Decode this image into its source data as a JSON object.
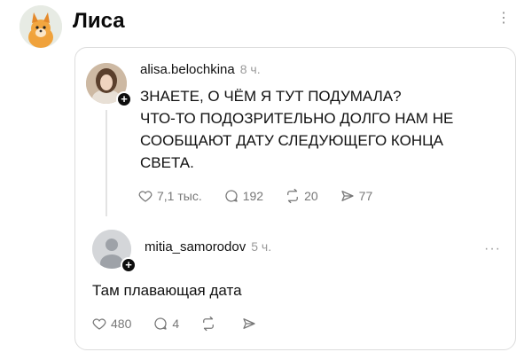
{
  "channel": {
    "name": "Лиса"
  },
  "post": {
    "username": "alisa.belochkina",
    "time": "8 ч.",
    "lines": [
      "ЗНАЕТЕ, О ЧЁМ Я ТУТ ПОДУМАЛА?",
      "ЧТО-ТО ПОДОЗРИТЕЛЬНО ДОЛГО НАМ НЕ",
      "СООБЩАЮТ ДАТУ СЛЕДУЮЩЕГО КОНЦА",
      "СВЕТА."
    ],
    "stats": {
      "likes": "7,1 тыс.",
      "comments": "192",
      "reposts": "20",
      "shares": "77"
    }
  },
  "reply": {
    "username": "mitia_samorodov",
    "time": "5 ч.",
    "text": "Там плавающая дата",
    "stats": {
      "likes": "480",
      "comments": "4"
    }
  },
  "icons": {
    "more": "vertical-ellipsis-icon",
    "reply_more": "horizontal-ellipsis-icon",
    "like": "heart-icon",
    "comment": "speech-bubble-icon",
    "repost": "repost-icon",
    "share": "send-icon",
    "follow": "plus-icon"
  }
}
